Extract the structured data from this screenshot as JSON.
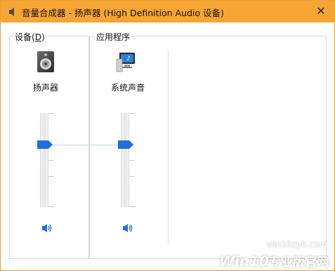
{
  "window": {
    "title": "音量合成器 - 扬声器 (High Definition Audio 设备)"
  },
  "devices": {
    "group_label_prefix": "设备(",
    "group_label_key": "D",
    "group_label_suffix": ")",
    "device_name": "扬声器",
    "volume_level": 0.7
  },
  "applications": {
    "group_label": "应用程序",
    "app_name": "系统声音",
    "volume_level": 0.7
  },
  "watermark": {
    "small": "win10zyb.com",
    "big": "Win10",
    "sub": "专业版官网"
  },
  "colors": {
    "titlebar": "#f7a532",
    "accent": "#1e6fd9"
  },
  "icons": {
    "title": "speaker-icon",
    "device": "speaker-device-icon",
    "app": "system-sounds-icon",
    "mute": "speaker-mute-icon",
    "close": "close-icon"
  }
}
